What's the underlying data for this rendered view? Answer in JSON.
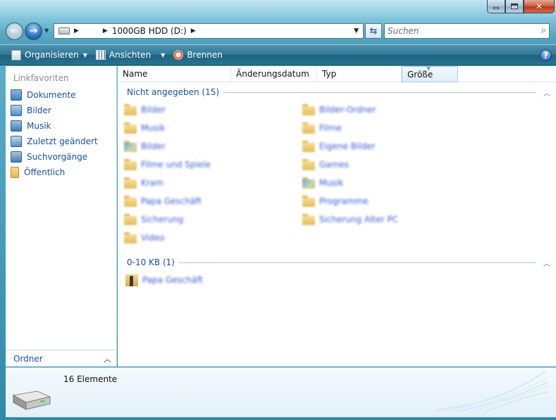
{
  "window": {
    "controls": {
      "minimize": "–",
      "maximize": "□",
      "close": "✕"
    }
  },
  "nav": {
    "back_icon": "arrow-left-icon",
    "forward_icon": "arrow-right-icon",
    "breadcrumb": [
      "1000GB HDD (D:)"
    ],
    "search_placeholder": "Suchen"
  },
  "commands": [
    {
      "label": "Organisieren",
      "icon": "organize-icon",
      "has_dropdown": true
    },
    {
      "label": "Ansichten",
      "icon": "views-icon",
      "has_dropdown": true
    },
    {
      "label": "Brennen",
      "icon": "burn-icon",
      "has_dropdown": false
    }
  ],
  "help_label": "?",
  "sidebar": {
    "header": "Linkfavoriten",
    "items": [
      {
        "label": "Dokumente",
        "icon": "documents-icon",
        "color": "#3f7fbf"
      },
      {
        "label": "Bilder",
        "icon": "pictures-icon",
        "color": "#4f8fc9"
      },
      {
        "label": "Musik",
        "icon": "music-icon",
        "color": "#3a7ab8"
      },
      {
        "label": "Zuletzt geändert",
        "icon": "recent-icon",
        "color": "#5a8fc2"
      },
      {
        "label": "Suchvorgänge",
        "icon": "searches-icon",
        "color": "#4a7db0"
      },
      {
        "label": "Öffentlich",
        "icon": "public-folder-icon",
        "color": "#e2b84f"
      }
    ],
    "footer_label": "Ordner"
  },
  "columns": {
    "name": "Name",
    "date": "Änderungsdatum",
    "type": "Typ",
    "size": "Größe"
  },
  "groups": [
    {
      "label": "Nicht angegeben (15)",
      "items": [
        {
          "name": "Bilder",
          "pic": false
        },
        {
          "name": "Bilder-Ordner",
          "pic": false
        },
        {
          "name": "Musik",
          "pic": false
        },
        {
          "name": "Filme",
          "pic": false
        },
        {
          "name": "Bilder",
          "pic": true
        },
        {
          "name": "Eigene Bilder",
          "pic": false
        },
        {
          "name": "Filme und Spiele",
          "pic": false
        },
        {
          "name": "Games",
          "pic": false
        },
        {
          "name": "Kram",
          "pic": false
        },
        {
          "name": "Musik",
          "pic": true
        },
        {
          "name": "Papa Geschäft",
          "pic": false
        },
        {
          "name": "Programme",
          "pic": false
        },
        {
          "name": "Sicherung",
          "pic": false
        },
        {
          "name": "Sicherung Alter PC",
          "pic": false
        },
        {
          "name": "Video",
          "pic": false
        }
      ]
    },
    {
      "label": "0-10 KB (1)",
      "items": [
        {
          "name": "Papa Geschäft"
        }
      ]
    }
  ],
  "details": {
    "count": "16 Elemente"
  }
}
